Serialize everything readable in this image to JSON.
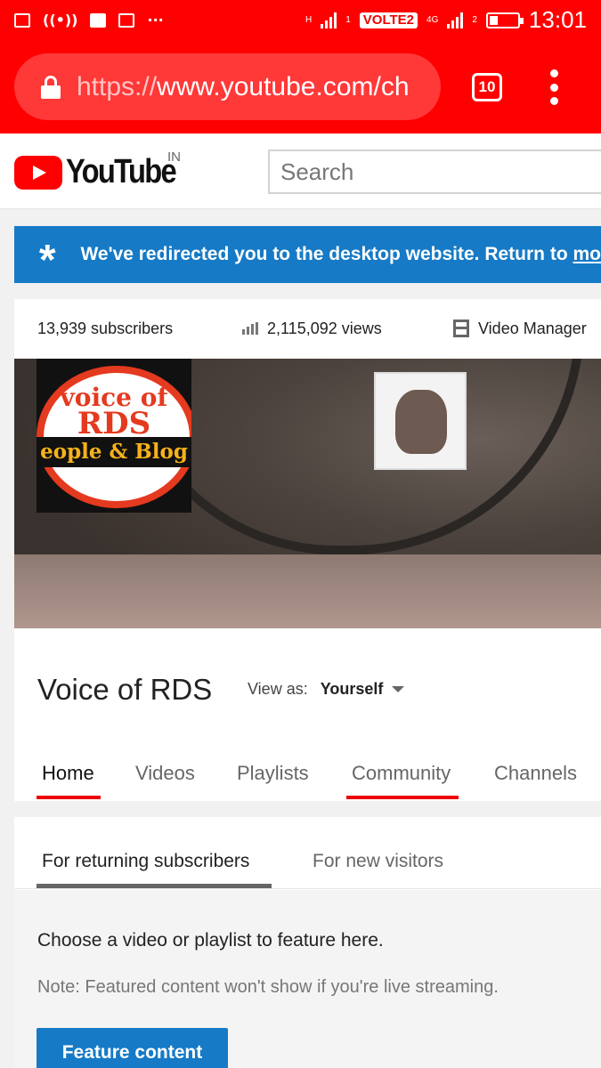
{
  "status_bar": {
    "carrier_label": "VOLTE2",
    "network_1": "H",
    "network_2": "4G",
    "sim_1": "1",
    "sim_2": "2",
    "time": "13:01",
    "more_indicator": "···",
    "battery_level": 0.3,
    "icons": [
      "image-icon",
      "hotspot-icon",
      "facebook-icon",
      "mail-icon",
      "signal-icon",
      "battery-icon"
    ]
  },
  "browser": {
    "url_scheme": "https://",
    "url_rest": "www.youtube.com/ch",
    "tab_count": "10",
    "accent_color": "#ff0000"
  },
  "header": {
    "logo_text": "YouTube",
    "country_code": "IN",
    "search_placeholder": "Search"
  },
  "redirect_banner": {
    "text": "We've redirected you to the desktop website. Return to ",
    "link_text": "mo"
  },
  "channel": {
    "subscribers": "13,939 subscribers",
    "views": "2,115,092 views",
    "video_manager": "Video Manager",
    "logo_line_1": "voice of",
    "logo_line_2": "RDS",
    "logo_line_3": "eople & Blog",
    "title": "Voice of RDS",
    "view_as_label": "View as:",
    "view_as_value": "Yourself",
    "tabs": [
      {
        "label": "Home"
      },
      {
        "label": "Videos"
      },
      {
        "label": "Playlists"
      },
      {
        "label": "Community"
      },
      {
        "label": "Channels"
      }
    ]
  },
  "featured": {
    "tabs": [
      {
        "label": "For returning subscribers"
      },
      {
        "label": "For new visitors"
      }
    ],
    "main_text": "Choose a video or playlist to feature here.",
    "note_text": "Note: Featured content won't show if you're live streaming.",
    "button_label": "Feature content",
    "button_color": "#167ac6"
  }
}
